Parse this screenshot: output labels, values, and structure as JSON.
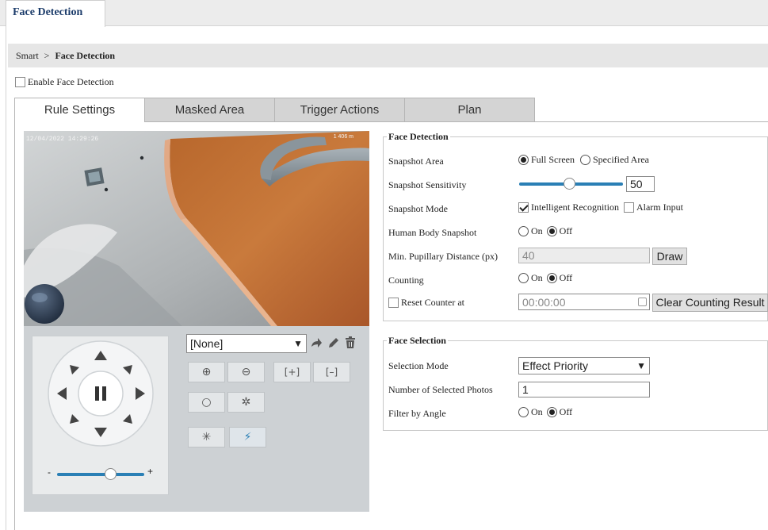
{
  "top_tab": "Face Detection",
  "breadcrumb": {
    "parent": "Smart",
    "separator": ">",
    "current": "Face Detection"
  },
  "enable": {
    "label": "Enable Face Detection",
    "checked": false
  },
  "tabs": [
    {
      "label": "Rule Settings",
      "active": true
    },
    {
      "label": "Masked Area",
      "active": false
    },
    {
      "label": "Trigger Actions",
      "active": false
    },
    {
      "label": "Plan",
      "active": false
    }
  ],
  "video": {
    "timestamp": "12/04/2022 14:29:26",
    "overlay_right": "1 406 m"
  },
  "ptz": {
    "preset_value": "[None]",
    "zoom_slider_minus": "-",
    "zoom_slider_plus": "+",
    "zoom_level": 0.6
  },
  "face_detection": {
    "legend": "Face Detection",
    "snapshot_area": {
      "label": "Snapshot Area",
      "options": [
        "Full Screen",
        "Specified Area"
      ],
      "selected": "Full Screen"
    },
    "snapshot_sensitivity": {
      "label": "Snapshot Sensitivity",
      "value": "50",
      "level": 0.5
    },
    "snapshot_mode": {
      "label": "Snapshot Mode",
      "options": [
        "Intelligent Recognition",
        "Alarm Input"
      ],
      "checked": [
        "Intelligent Recognition"
      ]
    },
    "human_body_snapshot": {
      "label": "Human Body Snapshot",
      "on": "On",
      "off": "Off",
      "selected": "Off"
    },
    "min_pupillary": {
      "label": "Min. Pupillary Distance (px)",
      "value": "40",
      "button": "Draw"
    },
    "counting": {
      "label": "Counting",
      "on": "On",
      "off": "Off",
      "selected": "Off"
    },
    "reset_counter": {
      "label": "Reset Counter at",
      "value": "00:00:00",
      "button": "Clear Counting Result"
    }
  },
  "face_selection": {
    "legend": "Face Selection",
    "selection_mode": {
      "label": "Selection Mode",
      "value": "Effect Priority"
    },
    "selected_photos": {
      "label": "Number of Selected Photos",
      "value": "1"
    },
    "filter_by_angle": {
      "label": "Filter by Angle",
      "on": "On",
      "off": "Off",
      "selected": "Off"
    }
  },
  "colors": {
    "accent": "#1d6fa5",
    "header_text": "#1d3d6b",
    "tab_inactive": "#d4d4d4"
  }
}
